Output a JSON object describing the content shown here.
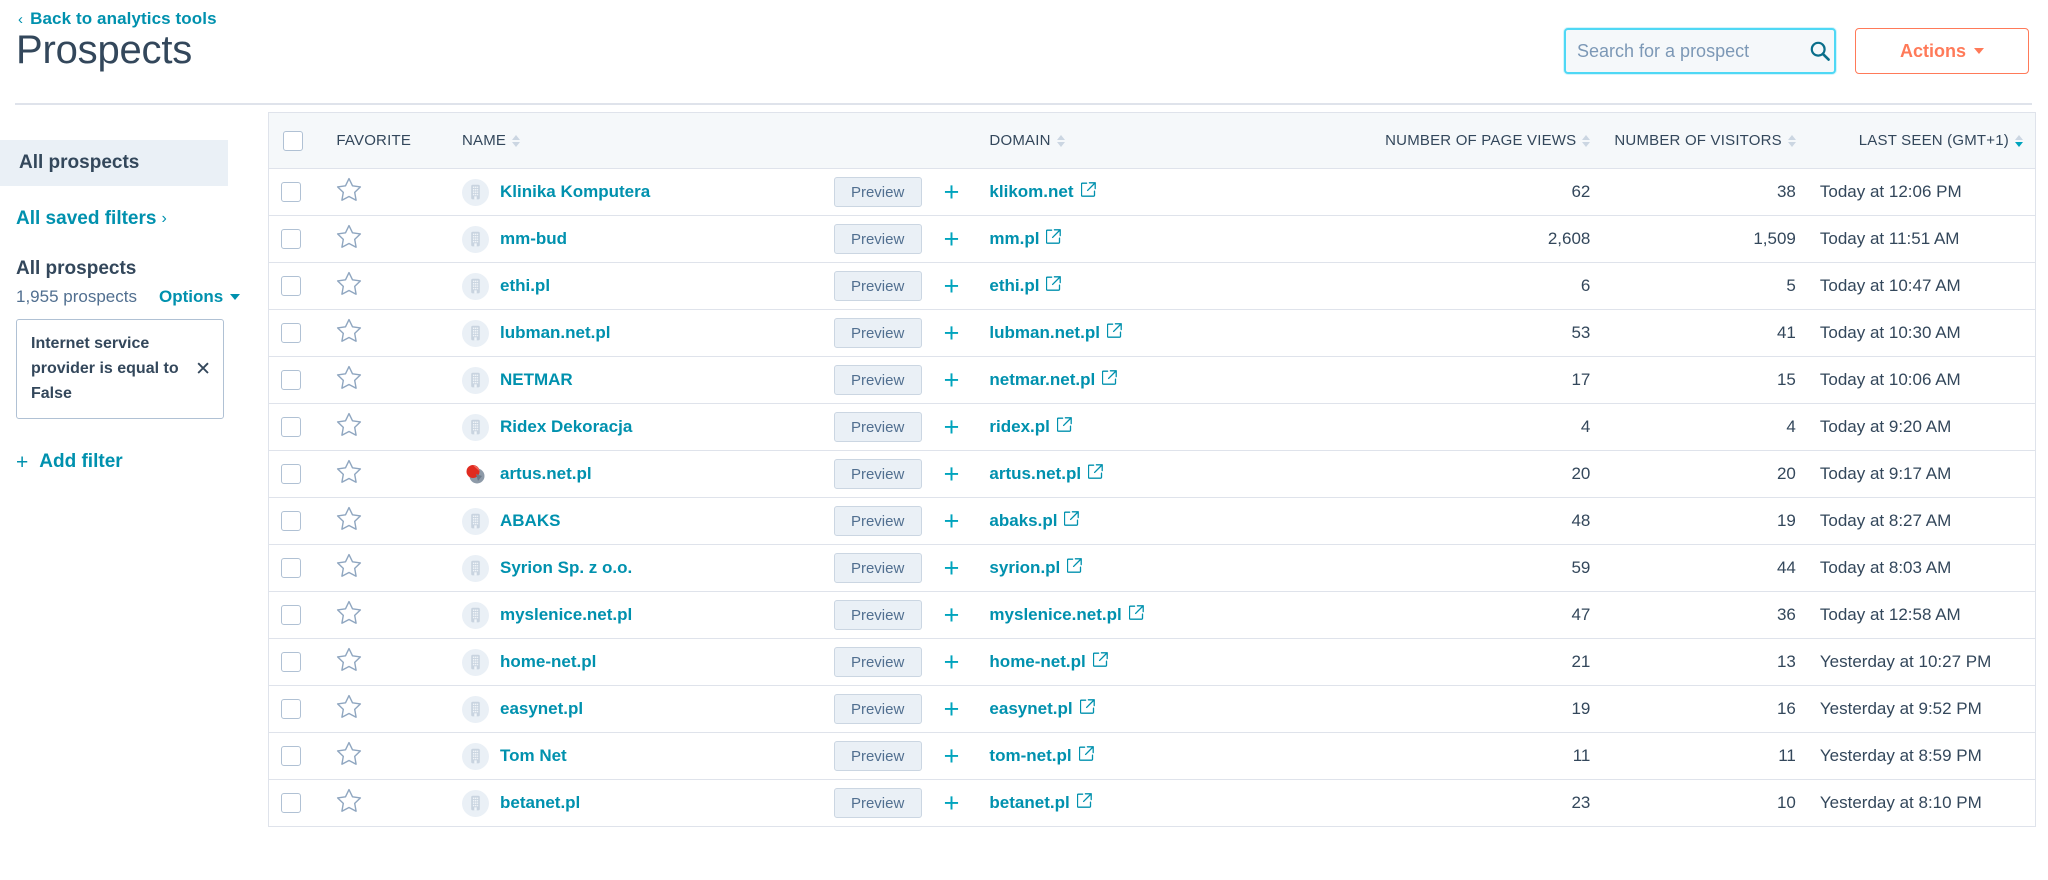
{
  "header": {
    "back_label": "Back to analytics tools",
    "back_icon": "chevron-left-icon",
    "title": "Prospects",
    "search": {
      "placeholder": "Search for a prospect",
      "value": "",
      "icon": "search-icon",
      "focus_color": "#4fd8f5"
    },
    "actions": {
      "label": "Actions",
      "icon": "caret-down-icon",
      "color": "#ff7a59"
    }
  },
  "sidebar": {
    "active_item": "All prospects",
    "saved_filters_label": "All saved filters",
    "saved_filters_icon": "chevron-right-icon",
    "group_title": "All prospects",
    "count_label": "1,955 prospects",
    "options_label": "Options",
    "options_icon": "caret-down-icon",
    "filter_chip": {
      "text": "Internet service provider is equal to False",
      "remove_icon": "close-icon"
    },
    "add_filter_label": "Add filter",
    "add_filter_icon": "plus-icon"
  },
  "table": {
    "select_all_checkbox": false,
    "columns": [
      {
        "key": "checkbox",
        "label": "",
        "sortable": false,
        "align": "left"
      },
      {
        "key": "favorite",
        "label": "FAVORITE",
        "sortable": false,
        "align": "left"
      },
      {
        "key": "name",
        "label": "NAME",
        "sortable": true,
        "align": "left"
      },
      {
        "key": "domain",
        "label": "DOMAIN",
        "sortable": true,
        "align": "left"
      },
      {
        "key": "page_views",
        "label": "NUMBER OF PAGE VIEWS",
        "sortable": true,
        "align": "right"
      },
      {
        "key": "visitors",
        "label": "NUMBER OF VISITORS",
        "sortable": true,
        "align": "right"
      },
      {
        "key": "last_seen",
        "label": "LAST SEEN (GMT+1)",
        "sortable": true,
        "align": "right"
      }
    ],
    "sorted_column": "last_seen",
    "sort_direction": "desc",
    "preview_label": "Preview",
    "add_icon": "plus-icon",
    "external_link_icon": "external-link-icon",
    "favorite_icon": "star-outline-icon",
    "rows": [
      {
        "name": "Klinika Komputera",
        "domain": "klikom.net",
        "page_views": "62",
        "visitors": "38",
        "last_seen": "Today at 12:06 PM",
        "avatar": "building-icon"
      },
      {
        "name": "mm-bud",
        "domain": "mm.pl",
        "page_views": "2,608",
        "visitors": "1,509",
        "last_seen": "Today at 11:51 AM",
        "avatar": "building-icon"
      },
      {
        "name": "ethi.pl",
        "domain": "ethi.pl",
        "page_views": "6",
        "visitors": "5",
        "last_seen": "Today at 10:47 AM",
        "avatar": "building-icon"
      },
      {
        "name": "lubman.net.pl",
        "domain": "lubman.net.pl",
        "page_views": "53",
        "visitors": "41",
        "last_seen": "Today at 10:30 AM",
        "avatar": "building-icon"
      },
      {
        "name": "NETMAR",
        "domain": "netmar.net.pl",
        "page_views": "17",
        "visitors": "15",
        "last_seen": "Today at 10:06 AM",
        "avatar": "building-icon"
      },
      {
        "name": "Ridex Dekoracja",
        "domain": "ridex.pl",
        "page_views": "4",
        "visitors": "4",
        "last_seen": "Today at 9:20 AM",
        "avatar": "building-icon"
      },
      {
        "name": "artus.net.pl",
        "domain": "artus.net.pl",
        "page_views": "20",
        "visitors": "20",
        "last_seen": "Today at 9:17 AM",
        "avatar": "favicon-red-icon"
      },
      {
        "name": "ABAKS",
        "domain": "abaks.pl",
        "page_views": "48",
        "visitors": "19",
        "last_seen": "Today at 8:27 AM",
        "avatar": "building-icon"
      },
      {
        "name": "Syrion Sp. z o.o.",
        "domain": "syrion.pl",
        "page_views": "59",
        "visitors": "44",
        "last_seen": "Today at 8:03 AM",
        "avatar": "building-icon"
      },
      {
        "name": "myslenice.net.pl",
        "domain": "myslenice.net.pl",
        "page_views": "47",
        "visitors": "36",
        "last_seen": "Today at 12:58 AM",
        "avatar": "building-icon"
      },
      {
        "name": "home-net.pl",
        "domain": "home-net.pl",
        "page_views": "21",
        "visitors": "13",
        "last_seen": "Yesterday at 10:27 PM",
        "avatar": "building-icon"
      },
      {
        "name": "easynet.pl",
        "domain": "easynet.pl",
        "page_views": "19",
        "visitors": "16",
        "last_seen": "Yesterday at 9:52 PM",
        "avatar": "building-icon"
      },
      {
        "name": "Tom Net",
        "domain": "tom-net.pl",
        "page_views": "11",
        "visitors": "11",
        "last_seen": "Yesterday at 8:59 PM",
        "avatar": "building-icon"
      },
      {
        "name": "betanet.pl",
        "domain": "betanet.pl",
        "page_views": "23",
        "visitors": "10",
        "last_seen": "Yesterday at 8:10 PM",
        "avatar": "building-icon"
      }
    ]
  },
  "colors": {
    "link": "#0091ae",
    "accent_orange": "#ff7a59",
    "text": "#33475b",
    "header_bg": "#f5f8fa",
    "sorted_bg": "#eaf0f6",
    "border": "#dfe3eb"
  }
}
